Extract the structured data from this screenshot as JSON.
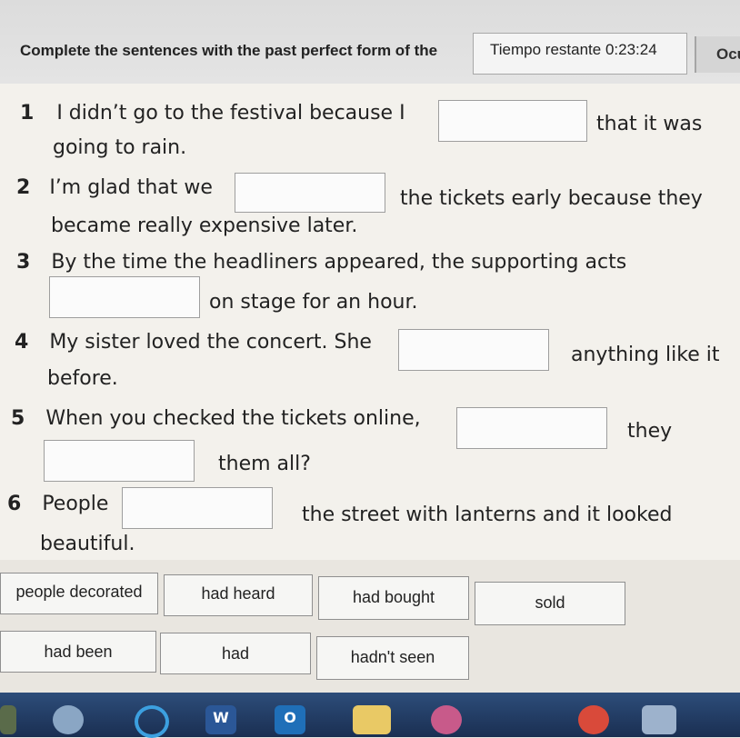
{
  "header": {
    "instruction": "Complete the sentences with the past perfect form of the",
    "timer_label": "Tiempo restante",
    "timer_value": "0:23:24",
    "hide_label": "Ocu"
  },
  "sentences": [
    {
      "number": "1",
      "before": "I didn’t go to the festival because I",
      "after": "that it was",
      "cont": "going to rain."
    },
    {
      "number": "2",
      "before": "I’m glad that we",
      "after": "the tickets early because they",
      "cont": "became really expensive later."
    },
    {
      "number": "3",
      "before": "By the time the headliners appeared, the supporting acts",
      "after": "on stage for an hour."
    },
    {
      "number": "4",
      "before": "My sister loved the concert. She",
      "after": "anything like it",
      "cont": "before."
    },
    {
      "number": "5",
      "before": "When you checked the tickets online,",
      "after": "they",
      "after2": "them all?"
    },
    {
      "number": "6",
      "before": "People",
      "after": "the street with lanterns and it looked",
      "cont": "beautiful."
    }
  ],
  "word_bank": [
    "people decorated",
    "had heard",
    "had bought",
    "sold",
    "had been",
    "had",
    "hadn't seen"
  ],
  "taskbar": {
    "icons": [
      "grid-icon",
      "paint-icon",
      "ie-icon",
      "word-icon",
      "outlook-icon",
      "explorer-icon",
      "app-icon",
      "chrome-icon",
      "keyboard-icon"
    ],
    "word_label": "W",
    "outlook_label": "O"
  }
}
